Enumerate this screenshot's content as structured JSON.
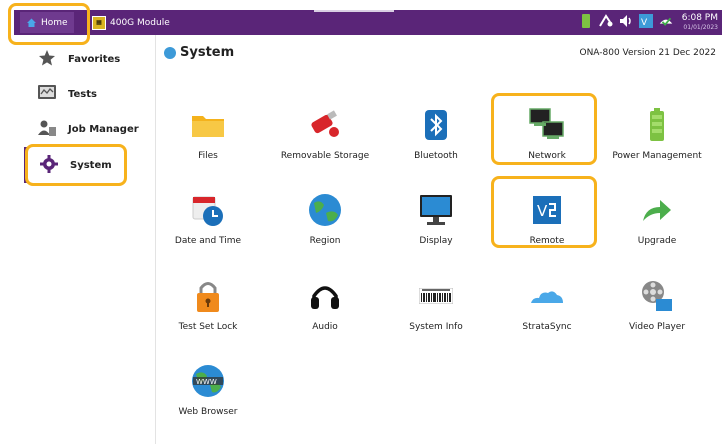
{
  "topbar": {
    "home_label": "Home",
    "module_label": "400G Module",
    "time": "6:08 PM",
    "date": "01/01/2023"
  },
  "sidebar": {
    "items": [
      {
        "label": "Favorites",
        "icon": "star-icon"
      },
      {
        "label": "Tests",
        "icon": "tests-icon"
      },
      {
        "label": "Job Manager",
        "icon": "job-manager-icon"
      },
      {
        "label": "System",
        "icon": "gear-icon"
      }
    ]
  },
  "main": {
    "title": "System",
    "version": "ONA-800 Version 21 Dec 2022",
    "apps": [
      {
        "label": "Files",
        "icon": "folder-icon"
      },
      {
        "label": "Removable Storage",
        "icon": "usb-drive-icon"
      },
      {
        "label": "Bluetooth",
        "icon": "bluetooth-icon"
      },
      {
        "label": "Network",
        "icon": "network-icon"
      },
      {
        "label": "Power Management",
        "icon": "battery-icon"
      },
      {
        "label": "Date and Time",
        "icon": "calendar-clock-icon"
      },
      {
        "label": "Region",
        "icon": "globe-icon"
      },
      {
        "label": "Display",
        "icon": "monitor-icon"
      },
      {
        "label": "Remote",
        "icon": "vnc-icon"
      },
      {
        "label": "Upgrade",
        "icon": "upgrade-arrow-icon"
      },
      {
        "label": "Test Set Lock",
        "icon": "padlock-icon"
      },
      {
        "label": "Audio",
        "icon": "headphones-icon"
      },
      {
        "label": "System Info",
        "icon": "barcode-icon"
      },
      {
        "label": "StrataSync",
        "icon": "cloud-icon"
      },
      {
        "label": "Video Player",
        "icon": "film-reel-icon"
      },
      {
        "label": "Web Browser",
        "icon": "www-globe-icon"
      }
    ]
  },
  "colors": {
    "topbar": "#5a2578",
    "highlight": "#f7b21c",
    "accent": "#3d9ad8"
  }
}
